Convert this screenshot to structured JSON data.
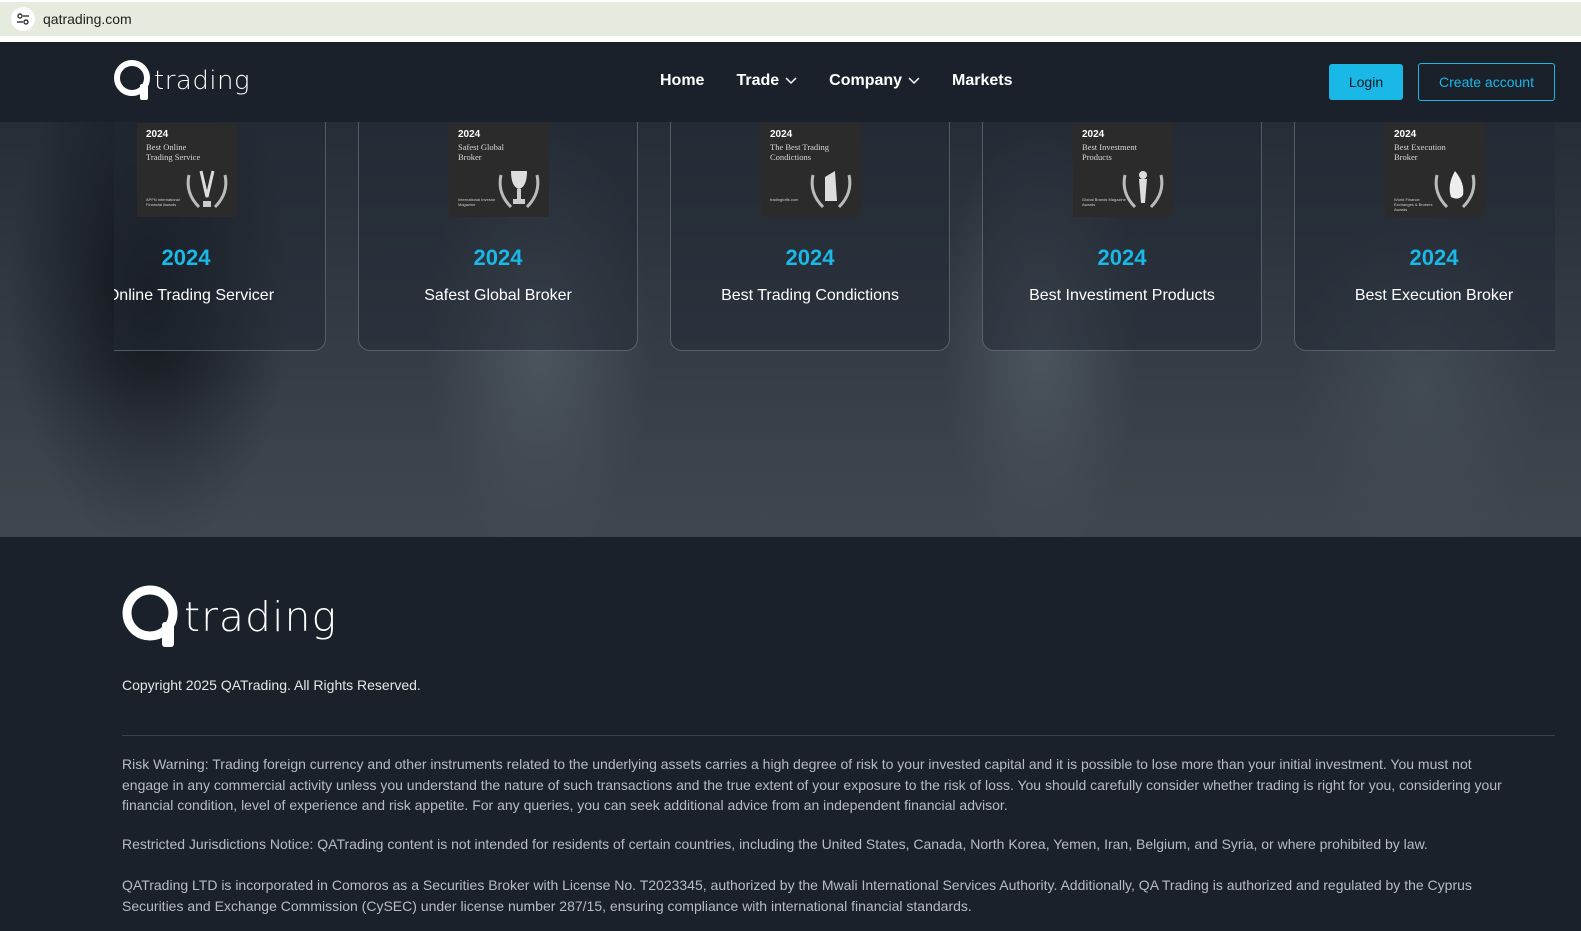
{
  "browser": {
    "url": "qatrading.com"
  },
  "header": {
    "logo_text": "trading",
    "nav": [
      {
        "label": "Home",
        "dropdown": false
      },
      {
        "label": "Trade",
        "dropdown": true
      },
      {
        "label": "Company",
        "dropdown": true
      },
      {
        "label": "Markets",
        "dropdown": false
      }
    ],
    "login_label": "Login",
    "create_account_label": "Create account"
  },
  "awards": [
    {
      "badge_year": "2024",
      "badge_name": "Best Online Trading Service",
      "badge_issuer": "APFN International Financial Awards",
      "year": "2024",
      "title": "t Online Trading Servicer"
    },
    {
      "badge_year": "2024",
      "badge_name": "Safest Global Broker",
      "badge_issuer": "International Investor Magazine",
      "year": "2024",
      "title": "Safest Global Broker"
    },
    {
      "badge_year": "2024",
      "badge_name": "The Best Trading Condictions",
      "badge_issuer": "tradingtoffs.com",
      "year": "2024",
      "title": "Best Trading Condictions"
    },
    {
      "badge_year": "2024",
      "badge_name": "Best Investment Products",
      "badge_issuer": "Global Brands Magazine Awards",
      "year": "2024",
      "title": "Best Investiment Products"
    },
    {
      "badge_year": "2024",
      "badge_name": "Best Execution Broker",
      "badge_issuer": "World Finance Exchanges & Brokers Awards",
      "year": "2024",
      "title": "Best Execution Broker"
    }
  ],
  "footer": {
    "logo_text": "trading",
    "copyright": "Copyright 2025 QATrading. All Rights Reserved.",
    "risk_warning": "Risk Warning: Trading foreign currency and other instruments related to the underlying assets carries a high degree of risk to your invested capital and it is possible to lose more than your initial investment. You must not engage in any commercial activity unless you understand the nature of such transactions and the true extent of your exposure to the risk of loss. You should carefully consider whether trading is right for you, considering your financial condition, level of experience and risk appetite. For any queries, you can seek additional advice from an independent financial advisor.",
    "restricted_notice": "Restricted Jurisdictions Notice: QATrading content is not intended for residents of certain countries, including the United States, Canada, North Korea, Yemen, Iran, Belgium, and Syria, or where prohibited by law.",
    "incorporation": "QATrading LTD is incorporated in Comoros as a Securities Broker with License No. T2023345, authorized by the Mwali International Services Authority. Additionally, QA Trading is authorized and regulated by the Cyprus Securities and Exchange Commission (CySEC) under license number 287/15, ensuring compliance with international financial standards."
  },
  "colors": {
    "accent": "#1ab8e6",
    "background": "#1a212b"
  }
}
